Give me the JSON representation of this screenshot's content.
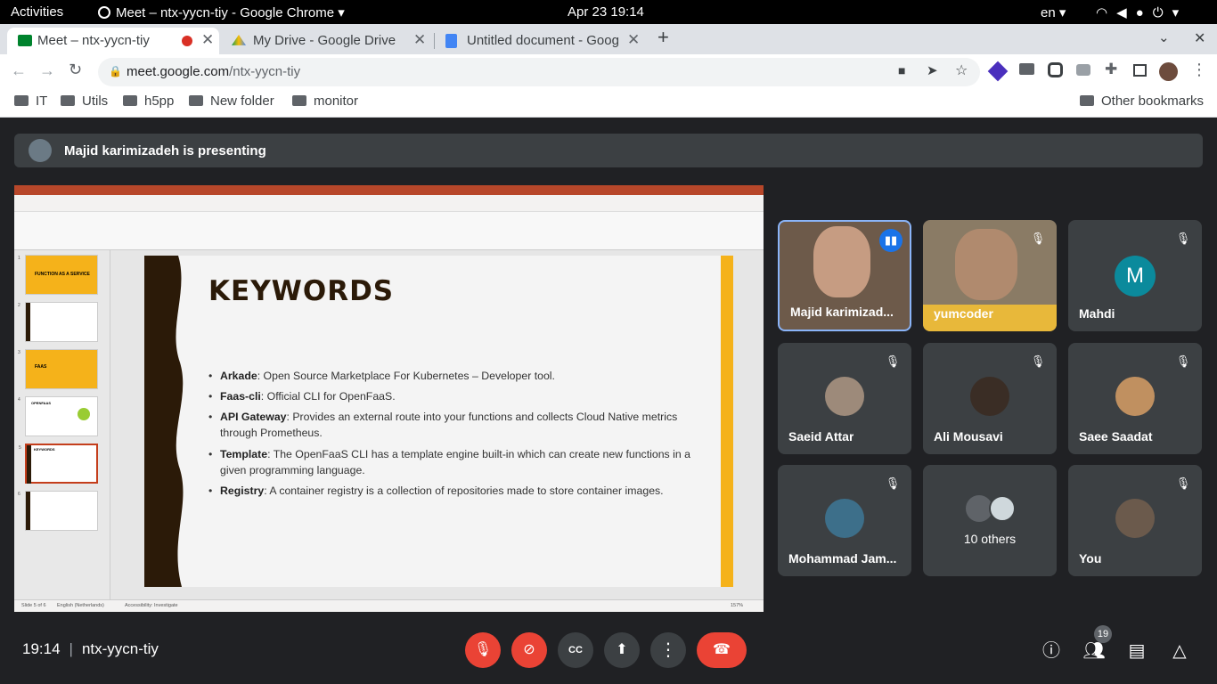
{
  "system": {
    "activities": "Activities",
    "window_title": "Meet – ntx-yycn-tiy - Google Chrome",
    "datetime": "Apr 23  19:14",
    "lang": "en"
  },
  "tabs": [
    {
      "label": "Meet – ntx-yycn-tiy"
    },
    {
      "label": "My Drive - Google Drive"
    },
    {
      "label": "Untitled document - Goog"
    }
  ],
  "toolbar": {
    "url_host": "meet.google.com",
    "url_path": "/ntx-yycn-tiy"
  },
  "bookmarks": [
    "IT",
    "Utils",
    "h5pp",
    "New folder",
    "monitor"
  ],
  "other_bookmarks": "Other bookmarks",
  "meet": {
    "presenting": "Majid karimizadeh is presenting",
    "meeting_code": "ntx-yycn-tiy",
    "time": "19:14",
    "participants_count": "19"
  },
  "slide": {
    "title": "KEYWORDS",
    "bullets": [
      {
        "term": "Arkade",
        "text": ": Open Source Marketplace For Kubernetes – Developer tool."
      },
      {
        "term": "Faas-cli",
        "text": ": Official CLI for OpenFaaS."
      },
      {
        "term": "API Gateway",
        "text": ": Provides an external route into your functions and collects Cloud Native metrics through Prometheus."
      },
      {
        "term": "Template",
        "text": ": The OpenFaaS CLI has a template engine built-in which can create new functions in a given programming language."
      },
      {
        "term": "Registry",
        "text": ": A container registry is a collection of repositories made to store container images."
      }
    ],
    "thumb_titles": [
      "FUNCTION AS A SERVICE",
      "FAAS",
      "OPENFAAS",
      "KEYWORDS"
    ],
    "status_slide": "Slide 5 of 6",
    "status_lang": "English (Netherlands)",
    "status_access": "Accessibility: Investigate",
    "zoom": "157%"
  },
  "participants": [
    {
      "name": "Majid karimizad...",
      "color": "#6d5a4a"
    },
    {
      "name": "yumcoder",
      "color": "#7a6a55"
    },
    {
      "name": "Mahdi",
      "initial": "M",
      "color": "#0b8a9c"
    },
    {
      "name": "Saeid Attar"
    },
    {
      "name": "Ali Mousavi"
    },
    {
      "name": "Saee Saadat"
    },
    {
      "name": "Mohammad Jam..."
    },
    {
      "name": "10 others"
    },
    {
      "name": "You"
    }
  ]
}
